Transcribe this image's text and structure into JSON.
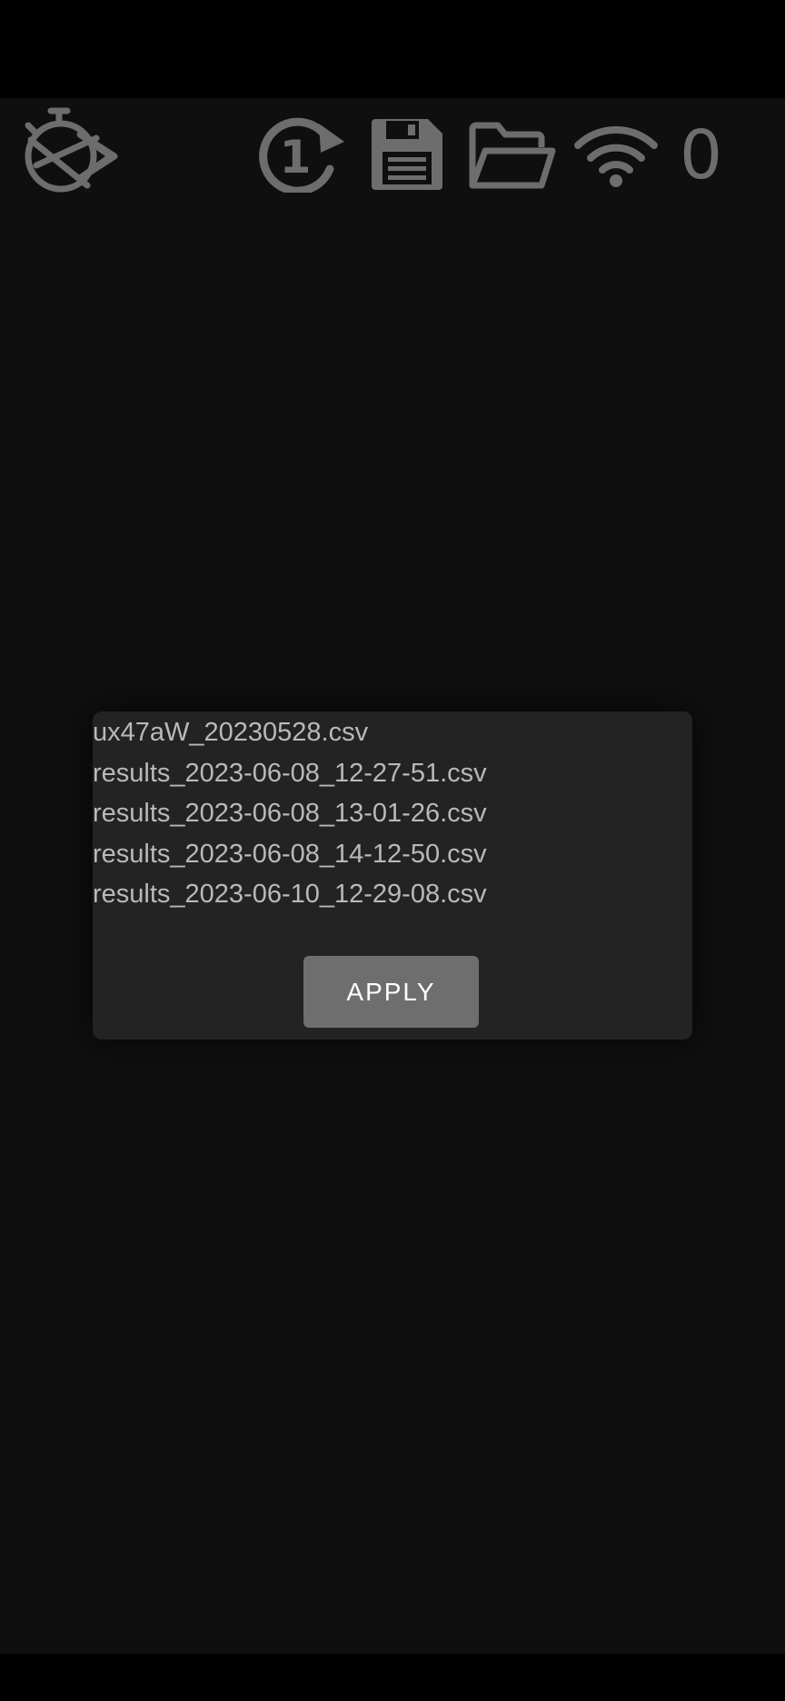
{
  "toolbar": {
    "icons": [
      {
        "name": "stopwatch-off-icon",
        "color": "#6d6d6d"
      },
      {
        "name": "repeat-once-icon",
        "color": "#6d6d6d"
      },
      {
        "name": "save-icon",
        "color": "#6d6d6d"
      },
      {
        "name": "folder-open-icon",
        "color": "#6d6d6d"
      },
      {
        "name": "wifi-icon",
        "color": "#6d6d6d"
      }
    ],
    "wifi_count": "0"
  },
  "dialog": {
    "files": [
      "ux47aW_20230528.csv",
      "results_2023-06-08_12-27-51.csv",
      "results_2023-06-08_13-01-26.csv",
      "results_2023-06-08_14-12-50.csv",
      "results_2023-06-10_12-29-08.csv"
    ],
    "apply_label": "APPLY"
  },
  "colors": {
    "background": "#0f0f0f",
    "dialog": "#232323",
    "icon": "#6d6d6d",
    "file_text": "#b9b9b9",
    "button": "#6e6e6e"
  }
}
